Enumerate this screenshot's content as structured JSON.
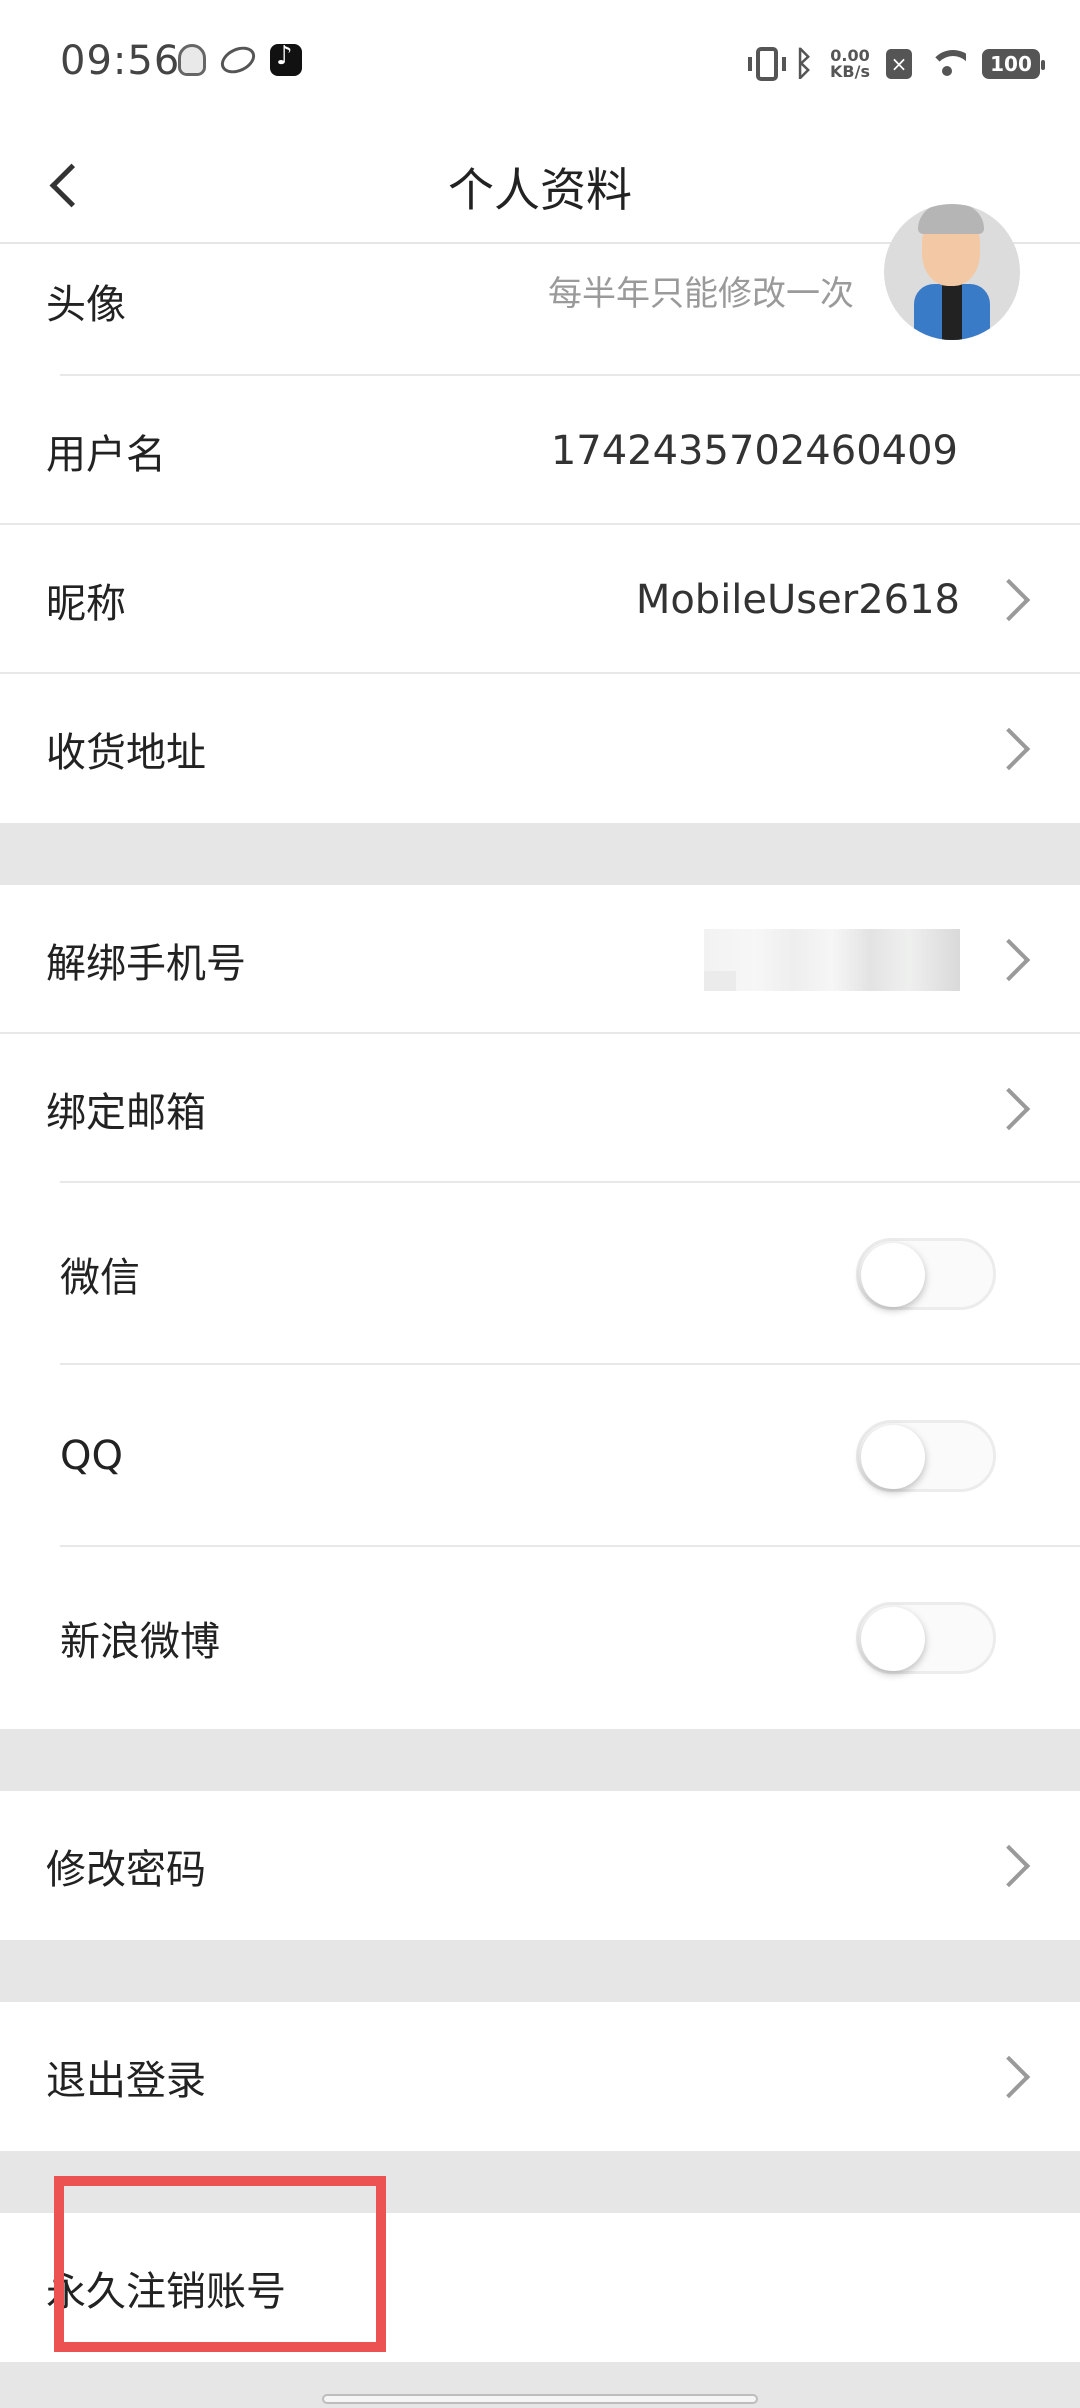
{
  "status_bar": {
    "time": "09:56",
    "net_speed_value": "0.00",
    "net_speed_unit": "KB/s",
    "battery": "100",
    "icons": [
      "qq-icon",
      "loop-icon",
      "tiktok-icon",
      "vibrate-icon",
      "bluetooth-icon",
      "x-icon",
      "wifi-icon",
      "battery-icon"
    ]
  },
  "header": {
    "title": "个人资料"
  },
  "profile": {
    "avatar_label": "头像",
    "avatar_hint": "每半年只能修改一次",
    "username_label": "用户名",
    "username_value": "1742435702460409",
    "nickname_label": "昵称",
    "nickname_value": "MobileUser2618",
    "address_label": "收货地址"
  },
  "binding": {
    "phone_label": "解绑手机号",
    "email_label": "绑定邮箱",
    "wechat_label": "微信",
    "qq_label": "QQ",
    "weibo_label": "新浪微博",
    "wechat_on": false,
    "qq_on": false,
    "weibo_on": false
  },
  "security": {
    "change_password_label": "修改密码",
    "logout_label": "退出登录",
    "delete_account_label": "永久注销账号"
  },
  "colors": {
    "highlight": "#ec5252",
    "section_gap": "#e6e6e6"
  }
}
